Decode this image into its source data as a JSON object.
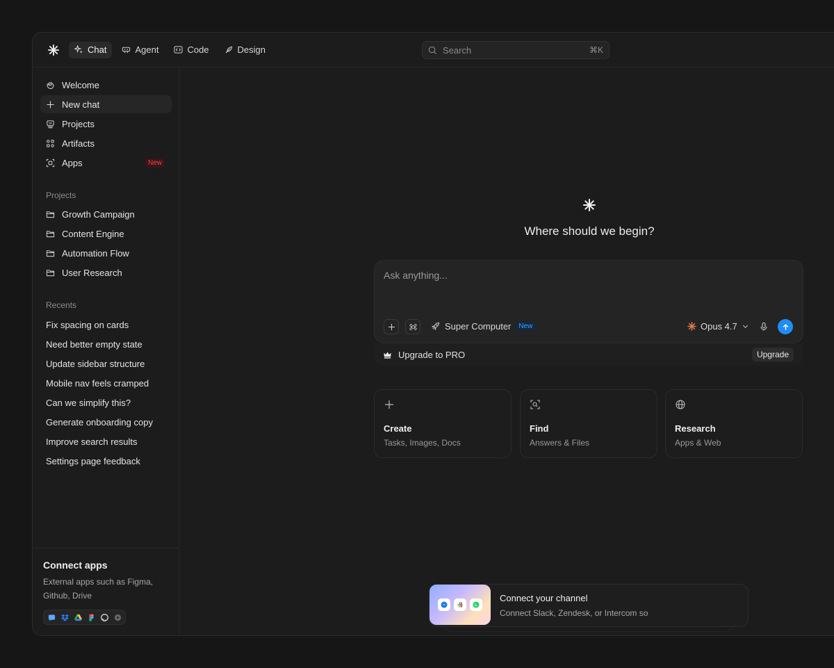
{
  "topbar": {
    "tabs": [
      {
        "label": "Chat",
        "icon": "sparkles-icon",
        "active": true
      },
      {
        "label": "Agent",
        "icon": "robot-icon"
      },
      {
        "label": "Code",
        "icon": "code-icon"
      },
      {
        "label": "Design",
        "icon": "feather-icon"
      }
    ],
    "search_placeholder": "Search",
    "search_shortcut": "⌘K"
  },
  "sidebar": {
    "items": [
      {
        "label": "Welcome",
        "icon": "hand-wave-icon"
      },
      {
        "label": "New chat",
        "icon": "plus-icon",
        "active": true
      },
      {
        "label": "Projects",
        "icon": "stack-icon"
      },
      {
        "label": "Artifacts",
        "icon": "grid-icon"
      },
      {
        "label": "Apps",
        "icon": "apps-icon",
        "badge": "New"
      }
    ],
    "projects_heading": "Projects",
    "projects": [
      "Growth Campaign",
      "Content Engine",
      "Automation Flow",
      "User Research"
    ],
    "recents_heading": "Recents",
    "recents": [
      "Fix spacing on cards",
      "Need better empty state",
      "Update sidebar structure",
      "Mobile nav feels cramped",
      "Can we simplify this?",
      "Generate onboarding copy",
      "Improve search results",
      "Settings page feedback"
    ],
    "connect": {
      "title": "Connect apps",
      "description": "External apps such as Figma, Github, Drive",
      "apps": [
        "messages-icon",
        "dropbox-icon",
        "google-drive-icon",
        "figma-icon",
        "github-icon",
        "more-icon"
      ]
    }
  },
  "main": {
    "title": "Where should we begin?",
    "composer": {
      "placeholder": "Ask anything...",
      "supercomputer_label": "Super Computer",
      "supercomputer_badge": "New",
      "model": "Opus 4.7"
    },
    "upgrade": {
      "label": "Upgrade to PRO",
      "button": "Upgrade"
    },
    "cards": [
      {
        "title": "Create",
        "subtitle": "Tasks, Images, Docs",
        "icon": "plus-icon"
      },
      {
        "title": "Find",
        "subtitle": "Answers & Files",
        "icon": "scan-search-icon"
      },
      {
        "title": "Research",
        "subtitle": "Apps & Web",
        "icon": "globe-icon"
      }
    ],
    "notification": {
      "title": "Connect your channel",
      "text": "Connect Slack, Zendesk, or Intercom so"
    }
  },
  "colors": {
    "background": "#161616",
    "window": "#1c1c1c",
    "accent_blue": "#1f8df5",
    "badge_red": "#e5484d",
    "model_orange": "#e07a4a"
  }
}
